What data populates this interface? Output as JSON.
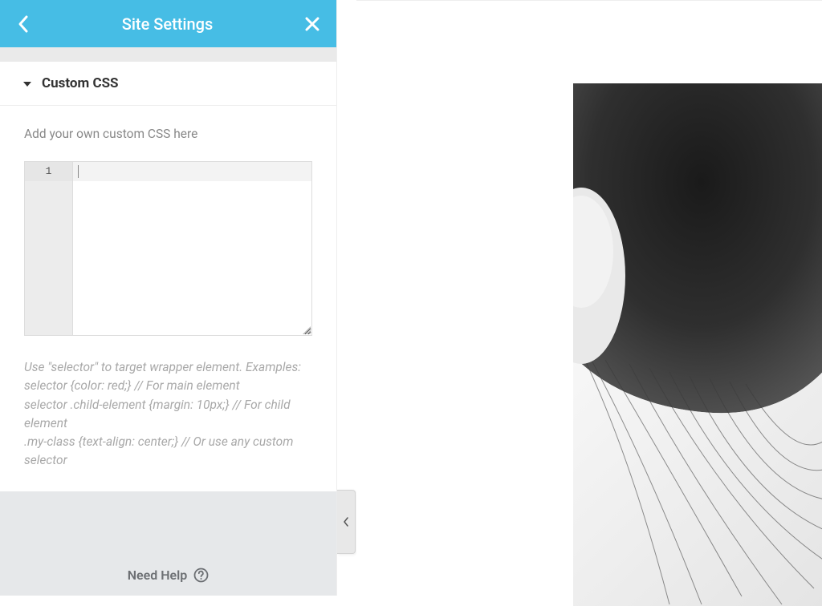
{
  "header": {
    "title": "Site Settings"
  },
  "section": {
    "label": "Custom CSS",
    "field_label": "Add your own custom CSS here",
    "gutter_line": "1",
    "help_text": "Use \"selector\" to target wrapper element. Examples:\nselector {color: red;} // For main element\nselector .child-element {margin: 10px;} // For child element\n.my-class {text-align: center;} // Or use any custom selector"
  },
  "footer": {
    "need_help": "Need Help"
  }
}
